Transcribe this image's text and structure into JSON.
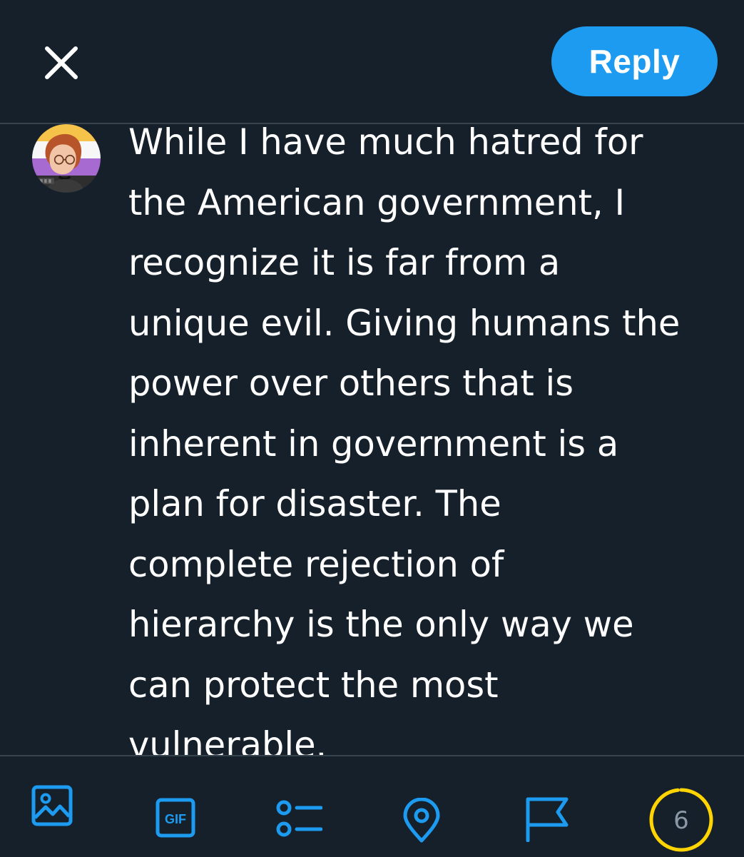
{
  "header": {
    "close_icon": "close-icon",
    "reply_label": "Reply"
  },
  "composer": {
    "avatar_icon": "user-avatar",
    "text": "While I have much hatred for\nthe American government, I\nrecognize it is far from a\nunique evil. Giving humans the\npower over others that is\ninherent in government is a\nplan for disaster. The\ncomplete rejection of\nhierarchy is the only way we\ncan protect the most\nvulnerable."
  },
  "toolbar": {
    "items": [
      {
        "icon": "image-icon"
      },
      {
        "icon": "gif-icon",
        "label": "GIF"
      },
      {
        "icon": "poll-icon"
      },
      {
        "icon": "location-icon"
      },
      {
        "icon": "flag-icon"
      }
    ],
    "char_counter": {
      "remaining": "6",
      "fill_fraction": 0.98
    }
  },
  "colors": {
    "background": "#15202b",
    "accent": "#1d9bf0",
    "divider": "#38444d",
    "counter_warning": "#ffd400",
    "muted_text": "#8b98a5"
  }
}
